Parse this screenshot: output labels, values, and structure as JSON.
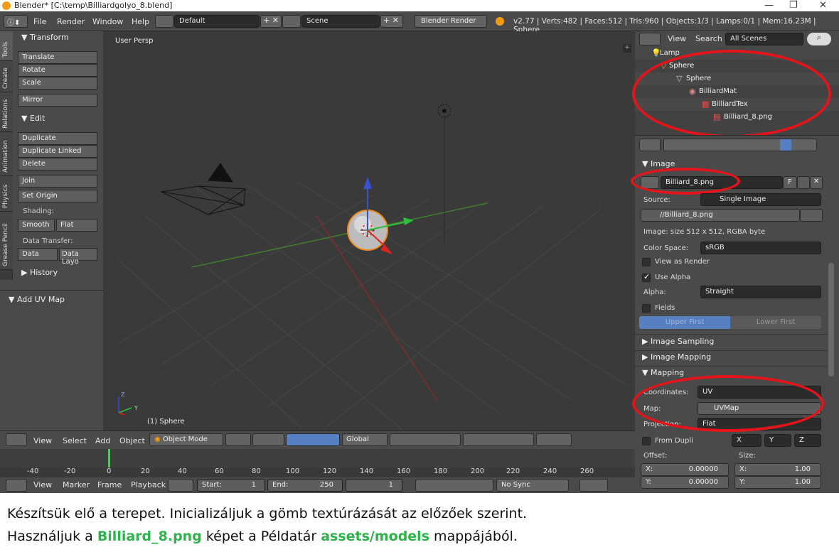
{
  "window": {
    "title": "Blender* [C:\\temp\\Billiardgolyo_8.blend]",
    "minimize": "—",
    "restore": "❐",
    "close": "✕"
  },
  "menubar": {
    "items": [
      "File",
      "Render",
      "Window",
      "Help"
    ],
    "layout": "Default",
    "scene": "Scene",
    "engine": "Blender Render",
    "stats": "v2.77 | Verts:482 | Faces:512 | Tris:960 | Objects:1/3 | Lamps:0/1 | Mem:16.23M | Sphere"
  },
  "tabs": [
    "Tools",
    "Create",
    "Relations",
    "Animation",
    "Physics",
    "Grease Pencil"
  ],
  "toolshelf": {
    "transform_header": "▼ Transform",
    "translate": "Translate",
    "rotate": "Rotate",
    "scale": "Scale",
    "mirror": "Mirror",
    "edit_header": "▼ Edit",
    "duplicate": "Duplicate",
    "duplicate_linked": "Duplicate Linked",
    "delete": "Delete",
    "join": "Join",
    "set_origin": "Set Origin",
    "shading_label": "Shading:",
    "smooth": "Smooth",
    "flat": "Flat",
    "data_transfer_label": "Data Transfer:",
    "data": "Data",
    "data_layo": "Data Layo",
    "history_header": "▶ History",
    "add_uv_map": "▼ Add UV Map"
  },
  "viewport": {
    "label": "User Persp",
    "selected": "(1) Sphere",
    "axis_z": "Z",
    "axis_y": "Y"
  },
  "vphdr": {
    "view": "View",
    "select": "Select",
    "add": "Add",
    "object": "Object",
    "mode": "Object Mode",
    "orientation": "Global"
  },
  "timeline": {
    "ticks": [
      "-40",
      "-20",
      "0",
      "20",
      "40",
      "60",
      "80",
      "100",
      "120",
      "140",
      "160",
      "180",
      "200",
      "220",
      "240",
      "260"
    ],
    "view": "View",
    "marker": "Marker",
    "frame": "Frame",
    "playback": "Playback",
    "start_label": "Start:",
    "start_value": "1",
    "end_label": "End:",
    "end_value": "250",
    "current": "1",
    "sync": "No Sync"
  },
  "outliner": {
    "view": "View",
    "search": "Search",
    "scenes": "All Scenes",
    "tree": [
      {
        "label": "Lamp",
        "indent": 0
      },
      {
        "label": "Sphere",
        "indent": 0
      },
      {
        "label": "Sphere",
        "indent": 1
      },
      {
        "label": "BilliardMat",
        "indent": 2
      },
      {
        "label": "BilliardTex",
        "indent": 3
      },
      {
        "label": "Billiard_8.png",
        "indent": 4
      }
    ]
  },
  "props": {
    "image_header": "▼ Image",
    "image_name": "Billiard_8.png",
    "image_flag": "F",
    "source_label": "Source:",
    "source_value": "Single Image",
    "filepath": "//Billiard_8.png",
    "image_info": "Image: size 512 x 512, RGBA byte",
    "color_space_label": "Color Space:",
    "color_space_value": "sRGB",
    "view_as_render": "View as Render",
    "use_alpha": "Use Alpha",
    "alpha_label": "Alpha:",
    "alpha_value": "Straight",
    "fields": "Fields",
    "upper_first": "Upper First",
    "lower_first": "Lower First",
    "image_sampling": "▶ Image Sampling",
    "image_mapping": "▶ Image Mapping",
    "mapping_header": "▼ Mapping",
    "coordinates_label": "Coordinates:",
    "coordinates_value": "UV",
    "map_label": "Map:",
    "map_value": "UVMap",
    "projection_label": "Projection:",
    "projection_value": "Flat",
    "from_dupli": "From Dupli",
    "x": "X",
    "y": "Y",
    "z": "Z",
    "offset_label": "Offset:",
    "size_label": "Size:",
    "offset_x_label": "X:",
    "offset_x": "0.00000",
    "offset_y_label": "Y:",
    "offset_y": "0.00000",
    "size_x_label": "X:",
    "size_x": "1.00",
    "size_y_label": "Y:",
    "size_y": "1.00"
  },
  "caption": {
    "line1": "Készítsük elő a terepet. Inicializáljuk a gömb textúrázását az előzőek szerint.",
    "line2_a": "Használjuk a ",
    "line2_b": "Billiard_8.png",
    "line2_c": " képet a Példatár ",
    "line2_d": "assets/models",
    "line2_e": " mappájából."
  },
  "colors": {
    "annotation": "#e4141b",
    "highlight": "#2db34a",
    "select_blue": "#5680c2"
  }
}
